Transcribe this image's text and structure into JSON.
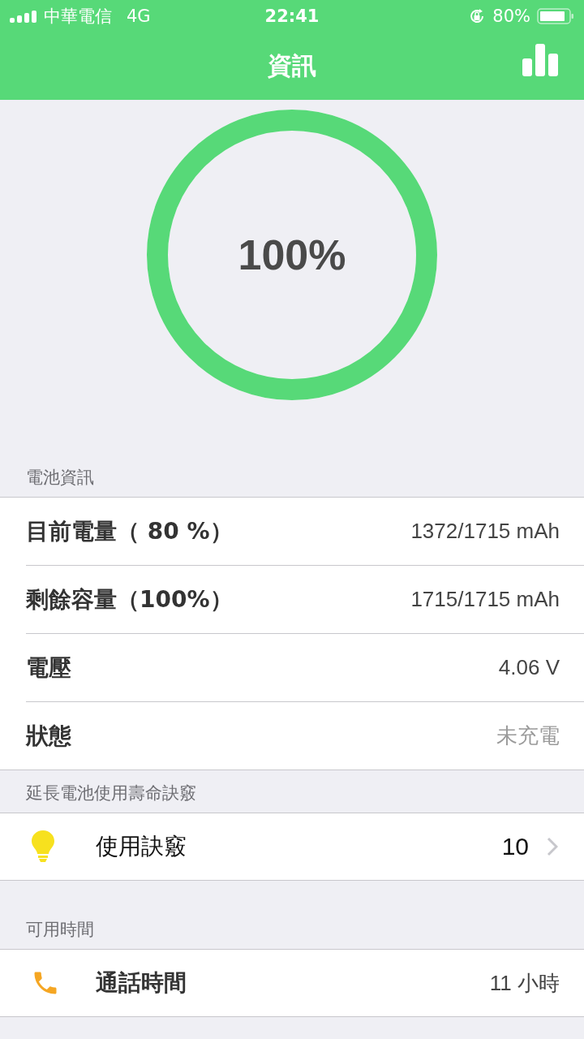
{
  "status_bar": {
    "carrier": "中華電信",
    "network": "4G",
    "time": "22:41",
    "battery": "80%"
  },
  "nav": {
    "title": "資訊"
  },
  "gauge": {
    "value": "100%",
    "level": 1
  },
  "sections": [
    {
      "header": "電池資訊",
      "rows": [
        {
          "label": "目前電量（ 80 %）",
          "value": "1372/1715 mAh",
          "dim": false
        },
        {
          "label": "剩餘容量（100%）",
          "value": "1715/1715 mAh",
          "dim": false
        },
        {
          "label": "電壓",
          "value": "4.06 V",
          "dim": false
        },
        {
          "label": "狀態",
          "value": "未充電",
          "dim": true
        }
      ]
    },
    {
      "header": "延長電池使用壽命訣竅",
      "rows": [
        {
          "kind": "bulb",
          "label": "使用訣竅",
          "value": "10",
          "chevron": true
        }
      ]
    },
    {
      "header": "可用時間",
      "rows": [
        {
          "kind": "phone",
          "label": "通話時間",
          "value": "11 小時",
          "chevron": false
        }
      ]
    }
  ]
}
